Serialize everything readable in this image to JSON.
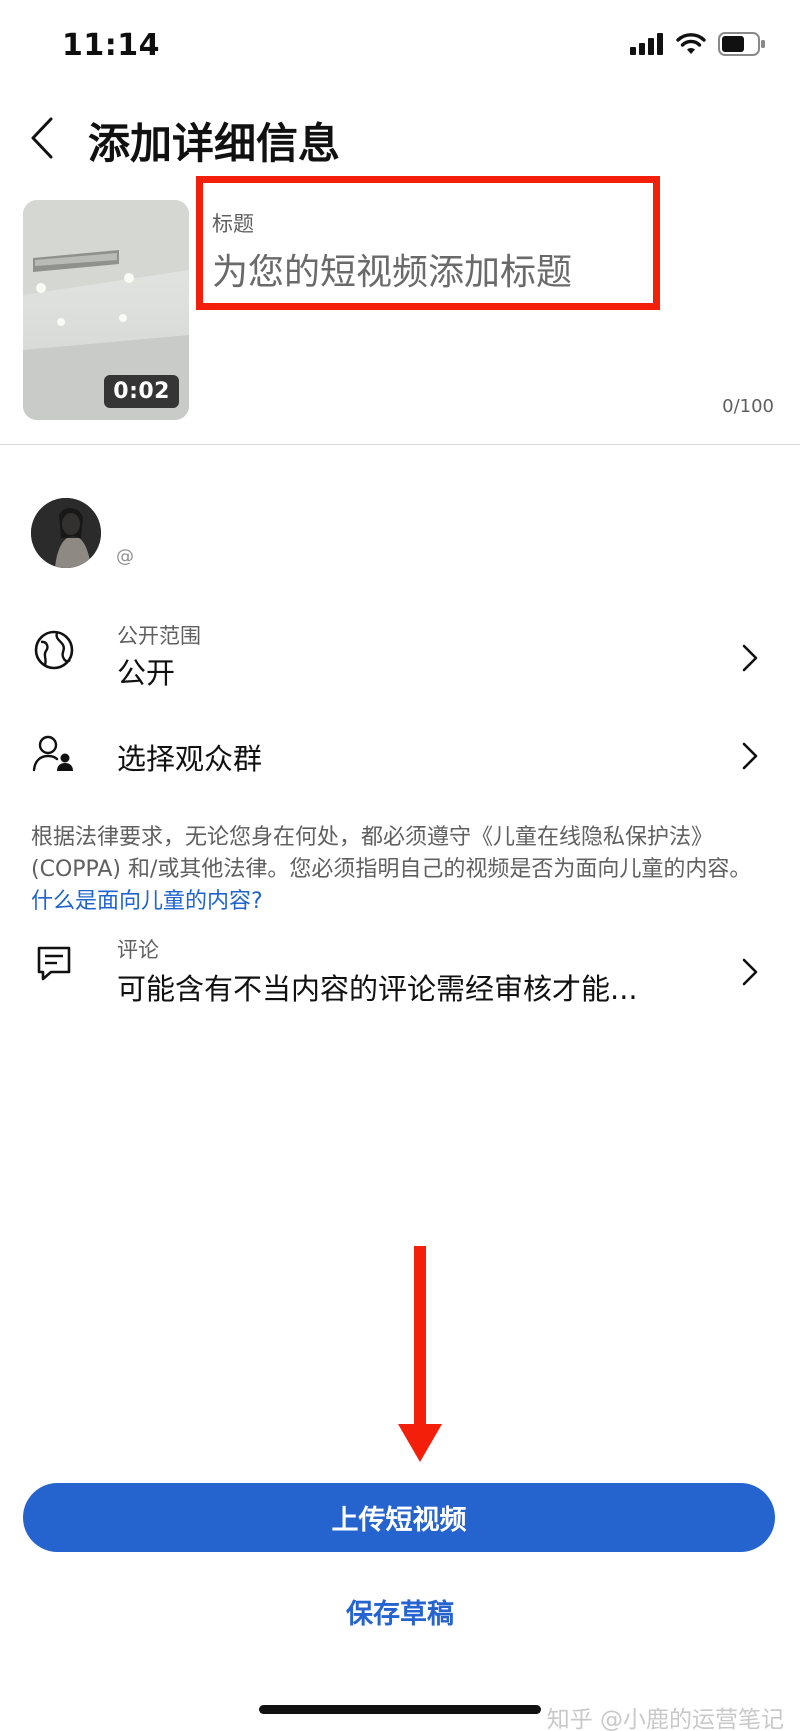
{
  "status_bar": {
    "time": "11:14",
    "icons": [
      "signal-icon",
      "wifi-icon",
      "battery-icon"
    ]
  },
  "header": {
    "title": "添加详细信息",
    "back_icon": "chevron-left-icon"
  },
  "video": {
    "duration": "0:02"
  },
  "title_field": {
    "label": "标题",
    "placeholder": "为您的短视频添加标题",
    "char_count": "0/100",
    "highlight_color": "#f41f0b"
  },
  "channel": {
    "handle": "@"
  },
  "visibility": {
    "label": "公开范围",
    "value": "公开",
    "icon": "globe-icon"
  },
  "audience": {
    "label": "选择观众群",
    "icon": "audience-icon"
  },
  "notice": {
    "text": "根据法律要求，无论您身在何处，都必须遵守《儿童在线隐私保护法》(COPPA) 和/或其他法律。您必须指明自己的视频是否为面向儿童的内容。",
    "link": "什么是面向儿童的内容?"
  },
  "comments": {
    "label": "评论",
    "value": "可能含有不当内容的评论需经审核才能...",
    "icon": "comment-icon"
  },
  "actions": {
    "upload": "上传短视频",
    "save_draft": "保存草稿"
  },
  "watermark": "知乎 @小鹿的运营笔记",
  "colors": {
    "accent": "#2563cf",
    "annotation": "#f41f0b"
  }
}
